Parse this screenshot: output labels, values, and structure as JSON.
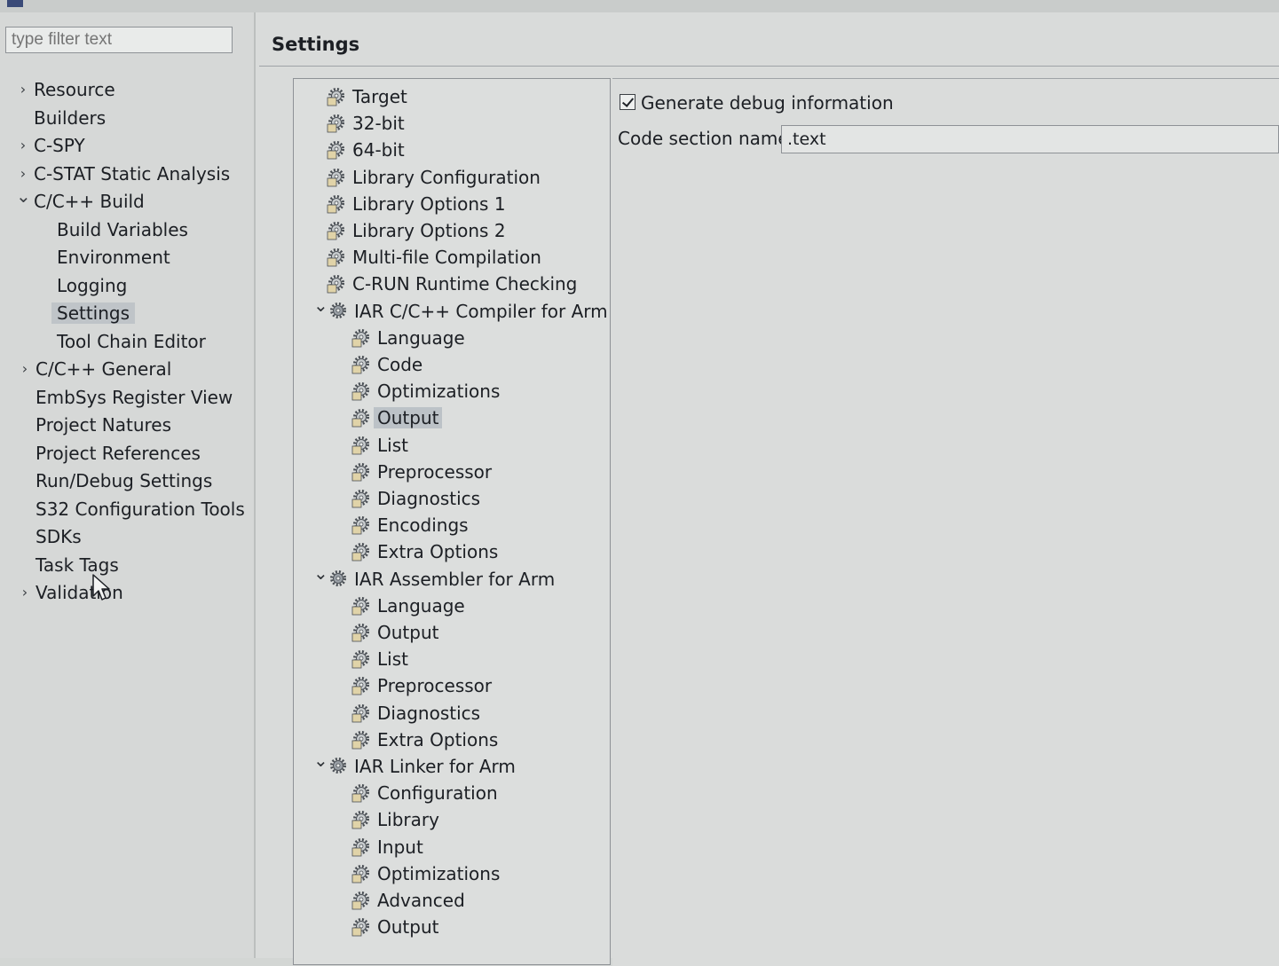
{
  "filter": {
    "placeholder": "type filter text"
  },
  "nav": {
    "items": [
      {
        "label": "Resource",
        "twisty": "collapsed"
      },
      {
        "label": "Builders",
        "twisty": "none"
      },
      {
        "label": "C-SPY",
        "twisty": "collapsed"
      },
      {
        "label": "C-STAT Static Analysis",
        "twisty": "collapsed"
      },
      {
        "label": "C/C++ Build",
        "twisty": "expanded"
      },
      {
        "label": "Build Variables",
        "twisty": "none"
      },
      {
        "label": "Environment",
        "twisty": "none"
      },
      {
        "label": "Logging",
        "twisty": "none"
      },
      {
        "label": "Settings",
        "twisty": "none",
        "selected": true
      },
      {
        "label": "Tool Chain Editor",
        "twisty": "none"
      },
      {
        "label": "C/C++ General",
        "twisty": "collapsed"
      },
      {
        "label": "EmbSys Register View",
        "twisty": "none"
      },
      {
        "label": "Project Natures",
        "twisty": "none"
      },
      {
        "label": "Project References",
        "twisty": "none"
      },
      {
        "label": "Run/Debug Settings",
        "twisty": "none"
      },
      {
        "label": "S32 Configuration Tools",
        "twisty": "none"
      },
      {
        "label": "SDKs",
        "twisty": "none"
      },
      {
        "label": "Task Tags",
        "twisty": "none"
      },
      {
        "label": "Validation",
        "twisty": "collapsed"
      }
    ]
  },
  "settings": {
    "title": "Settings",
    "tree": [
      {
        "label": "Target",
        "kind": "page"
      },
      {
        "label": "32-bit",
        "kind": "page"
      },
      {
        "label": "64-bit",
        "kind": "page"
      },
      {
        "label": "Library Configuration",
        "kind": "page"
      },
      {
        "label": "Library Options 1",
        "kind": "page"
      },
      {
        "label": "Library Options 2",
        "kind": "page"
      },
      {
        "label": "Multi-file Compilation",
        "kind": "page"
      },
      {
        "label": "C-RUN Runtime Checking",
        "kind": "page"
      },
      {
        "label": "IAR C/C++ Compiler for Arm",
        "kind": "tool",
        "twisty": "expanded"
      },
      {
        "label": "Language",
        "kind": "page"
      },
      {
        "label": "Code",
        "kind": "page"
      },
      {
        "label": "Optimizations",
        "kind": "page"
      },
      {
        "label": "Output",
        "kind": "page",
        "selected": true
      },
      {
        "label": "List",
        "kind": "page"
      },
      {
        "label": "Preprocessor",
        "kind": "page"
      },
      {
        "label": "Diagnostics",
        "kind": "page"
      },
      {
        "label": "Encodings",
        "kind": "page"
      },
      {
        "label": "Extra Options",
        "kind": "page"
      },
      {
        "label": "IAR Assembler for Arm",
        "kind": "tool",
        "twisty": "expanded"
      },
      {
        "label": "Language",
        "kind": "page"
      },
      {
        "label": "Output",
        "kind": "page"
      },
      {
        "label": "List",
        "kind": "page"
      },
      {
        "label": "Preprocessor",
        "kind": "page"
      },
      {
        "label": "Diagnostics",
        "kind": "page"
      },
      {
        "label": "Extra Options",
        "kind": "page"
      },
      {
        "label": "IAR Linker for Arm",
        "kind": "tool",
        "twisty": "expanded"
      },
      {
        "label": "Configuration",
        "kind": "page"
      },
      {
        "label": "Library",
        "kind": "page"
      },
      {
        "label": "Input",
        "kind": "page"
      },
      {
        "label": "Optimizations",
        "kind": "page"
      },
      {
        "label": "Advanced",
        "kind": "page"
      },
      {
        "label": "Output",
        "kind": "page"
      }
    ],
    "options": {
      "generate_debug_label": "Generate debug information",
      "generate_debug_checked": true,
      "code_section_label": "Code section name:",
      "code_section_value": ".text"
    }
  },
  "colors": {
    "selection": "#bcc2c7",
    "background": "#d6d8d7",
    "text": "#1c1f24"
  },
  "icons": {
    "page": "settings-gear-icon",
    "tool": "tool-gear-icon",
    "expanded": "chevron-down-icon",
    "collapsed": "chevron-right-icon"
  }
}
